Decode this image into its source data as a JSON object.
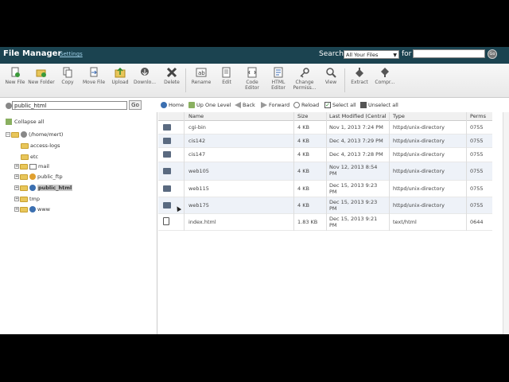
{
  "header": {
    "title": "File Manager",
    "settings_link": "Settings",
    "search_label": "Search",
    "search_scope": "All Your Files",
    "for_label": "for",
    "search_value": "",
    "go_label": "Go"
  },
  "toolbar": {
    "new_file": "New File",
    "new_folder": "New Folder",
    "copy": "Copy",
    "move_file": "Move File",
    "upload": "Upload",
    "download": "Downlo...",
    "delete": "Delete",
    "rename": "Rename",
    "edit": "Edit",
    "code_editor": "Code Editor",
    "html_editor": "HTML Editor",
    "change_perms": "Change Permiss...",
    "view": "View",
    "extract": "Extract",
    "compress": "Compr..."
  },
  "pathbar": {
    "path": "public_html",
    "go": "Go"
  },
  "actions": {
    "home": "Home",
    "up_one_level": "Up One Level",
    "back": "Back",
    "forward": "Forward",
    "reload": "Reload",
    "select_all": "Select all",
    "unselect_all": "Unselect all"
  },
  "tree": {
    "collapse_all": "Collapse all",
    "root": "(/home/mert)",
    "items": [
      "access-logs",
      "etc",
      "mail",
      "public_ftp",
      "public_html",
      "tmp",
      "www"
    ]
  },
  "table": {
    "columns": [
      "Name",
      "Size",
      "Last Modified (Central S",
      "Type",
      "Perms"
    ],
    "rows": [
      {
        "name": "cgi-bin",
        "size": "4 KB",
        "modified": "Nov 1, 2013 7:24 PM",
        "type": "httpd/unix-directory",
        "perms": "0755"
      },
      {
        "name": "cis142",
        "size": "4 KB",
        "modified": "Dec 4, 2013 7:29 PM",
        "type": "httpd/unix-directory",
        "perms": "0755"
      },
      {
        "name": "cis147",
        "size": "4 KB",
        "modified": "Dec 4, 2013 7:28 PM",
        "type": "httpd/unix-directory",
        "perms": "0755"
      },
      {
        "name": "web105",
        "size": "4 KB",
        "modified": "Nov 12, 2013 8:54 PM",
        "type": "httpd/unix-directory",
        "perms": "0755"
      },
      {
        "name": "web115",
        "size": "4 KB",
        "modified": "Dec 15, 2013 9:23 PM",
        "type": "httpd/unix-directory",
        "perms": "0755"
      },
      {
        "name": "web175",
        "size": "4 KB",
        "modified": "Dec 15, 2013 9:23 PM",
        "type": "httpd/unix-directory",
        "perms": "0755"
      },
      {
        "name": "index.html",
        "size": "1.83 KB",
        "modified": "Dec 15, 2013 9:21 PM",
        "type": "text/html",
        "perms": "0644"
      }
    ]
  }
}
